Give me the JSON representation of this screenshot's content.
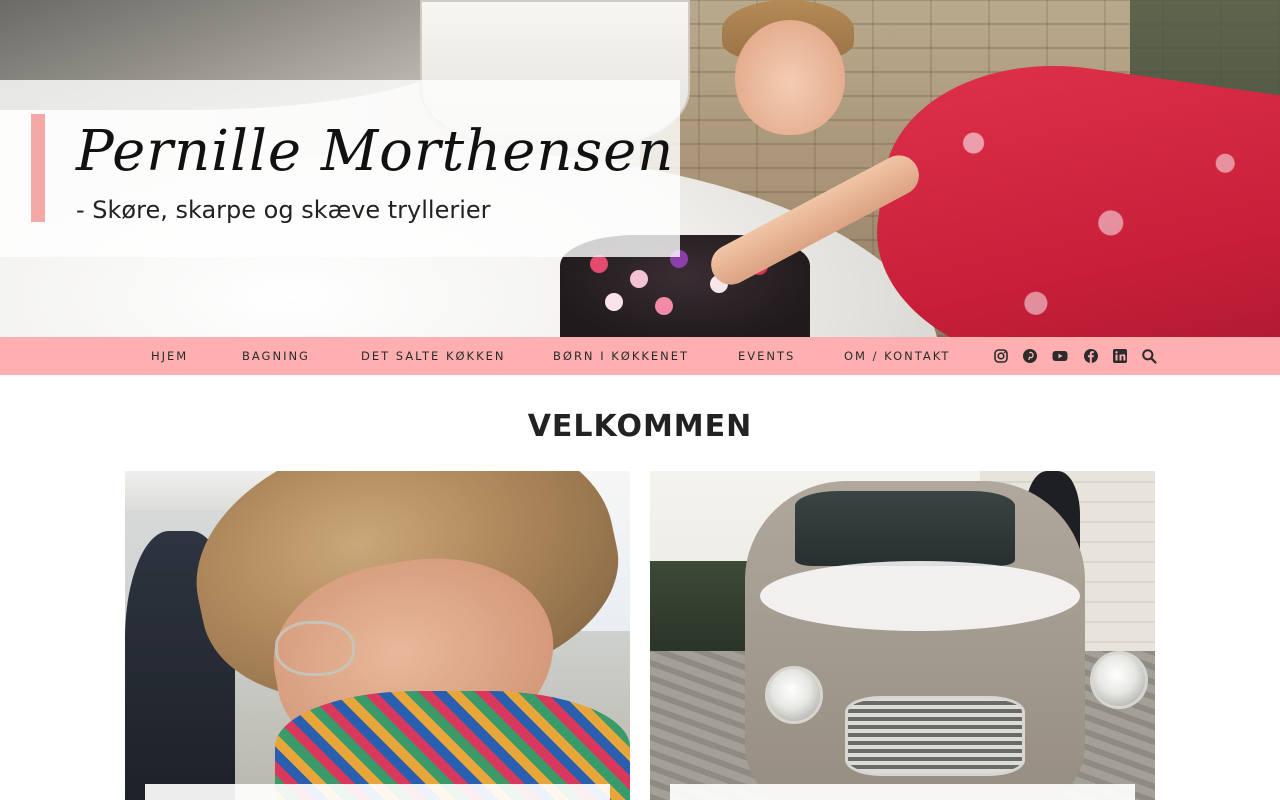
{
  "header": {
    "logo_title": "Pernille Morthensen",
    "logo_tagline": "- Skøre, skarpe og skæve tryllerier"
  },
  "nav": {
    "items": [
      {
        "label": "HJEM"
      },
      {
        "label": "BAGNING"
      },
      {
        "label": "DET SALTE KØKKEN"
      },
      {
        "label": "BØRN I KØKKENET"
      },
      {
        "label": "EVENTS"
      },
      {
        "label": "OM / KONTAKT"
      }
    ],
    "icons": [
      "instagram-icon",
      "pinterest-icon",
      "youtube-icon",
      "facebook-icon",
      "linkedin-icon",
      "search-icon"
    ]
  },
  "main": {
    "section_title": "VELKOMMEN"
  },
  "colors": {
    "nav_background": "#ffafaf",
    "logo_accent": "#f5a9a6",
    "text": "#222222"
  }
}
